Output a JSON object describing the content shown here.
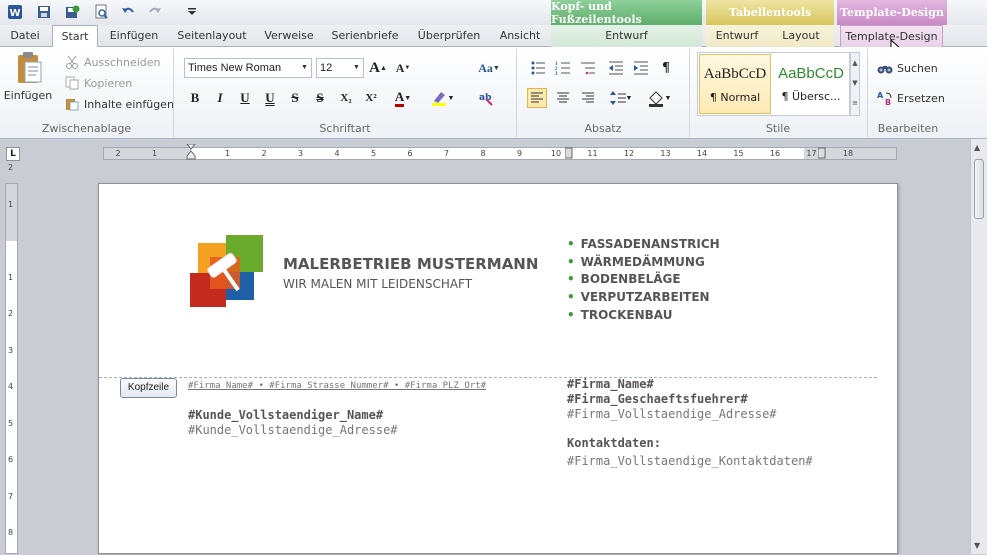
{
  "quick_access": {
    "icons": [
      "word-app-icon",
      "save-icon",
      "save-as-icon",
      "print-preview-icon",
      "undo-icon",
      "redo-icon",
      "customize-quick-access-icon"
    ]
  },
  "context_groups": {
    "kopf": "Kopf- und Fußzeilentools",
    "tabellen": "Tabellentools",
    "template": "Template-Design"
  },
  "tabs": {
    "datei": "Datei",
    "start": "Start",
    "einfuegen": "Einfügen",
    "seitenlayout": "Seitenlayout",
    "verweise": "Verweise",
    "serienbriefe": "Serienbriefe",
    "ueberpruefen": "Überprüfen",
    "ansicht": "Ansicht",
    "entwurf_kopf": "Entwurf",
    "entwurf_tab": "Entwurf",
    "layout": "Layout",
    "template_design": "Template-Design"
  },
  "clipboard": {
    "paste": "Einfügen",
    "cut": "Ausschneiden",
    "copy": "Kopieren",
    "paste_content": "Inhalte einfügen",
    "label": "Zwischenablage"
  },
  "font": {
    "name": "Times New Roman",
    "size": "12",
    "label": "Schriftart",
    "bold": "B",
    "italic": "I",
    "underline": "U",
    "double_underline": "U",
    "strike": "S",
    "double_strike": "S",
    "subscript": "X₂",
    "superscript": "X²",
    "font_color": "A",
    "grow": "A",
    "shrink": "A",
    "change_case": "Aa"
  },
  "paragraph": {
    "label": "Absatz",
    "pilcrow": "¶"
  },
  "styles": {
    "label": "Stile",
    "normal_preview": "AaBbCcD",
    "normal_name": "¶ Normal",
    "heading_preview": "AaBbCcD",
    "heading_name": "¶ Übersc...",
    "heading_color": "#2e8b2e"
  },
  "editing": {
    "label": "Bearbeiten",
    "find": "Suchen",
    "replace": "Ersetzen"
  },
  "ruler": {
    "h_ticks": [
      "2",
      "1",
      "1",
      "2",
      "3",
      "4",
      "5",
      "6",
      "7",
      "8",
      "9",
      "10",
      "11",
      "12",
      "13",
      "14",
      "15",
      "16",
      "17",
      "18"
    ],
    "v_ticks": [
      "2",
      "1",
      "1",
      "2",
      "3",
      "4",
      "5",
      "6",
      "7",
      "8"
    ]
  },
  "document": {
    "company_name": "MALERBETRIEB MUSTERMANN",
    "tagline": "WIR MALEN MIT LEIDENSCHAFT",
    "services": [
      "FASSADENANSTRICH",
      "WÄRMEDÄMMUNG",
      "BODENBELÄGE",
      "VERPUTZARBEITEN",
      "TROCKENBAU"
    ],
    "header_tag": "Kopfzeile",
    "sender_line": "#Firma_Name# • #Firma_Strasse_Nummer# • #Firma_PLZ_Ort#",
    "customer_name": "#Kunde_Vollstaendiger_Name#",
    "customer_address": "#Kunde_Vollstaendige_Adresse#",
    "firm_name": "#Firma_Name#",
    "firm_manager": "#Firma_Geschaeftsfuehrer#",
    "firm_address": "#Firma_Vollstaendige_Adresse#",
    "contact_label": "Kontaktdaten:",
    "contact_value": "#Firma_Vollstaendige_Kontaktdaten#",
    "accent_green": "#3c9a3c"
  }
}
